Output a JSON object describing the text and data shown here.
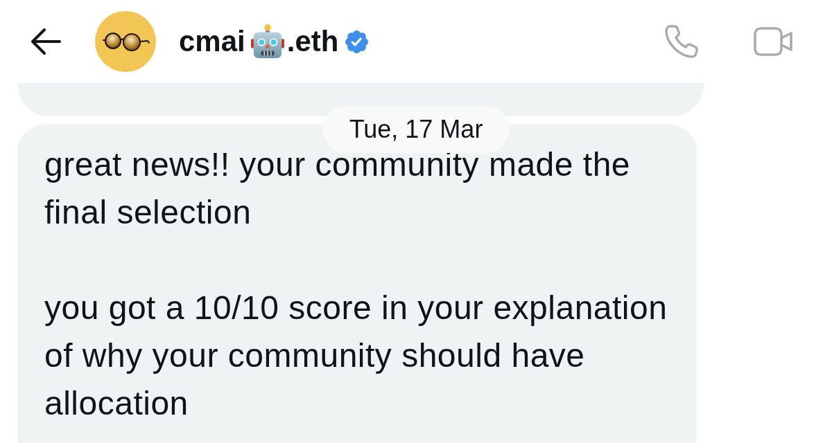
{
  "header": {
    "contact": {
      "name": "cmai",
      "name_suffix": ".eth",
      "verified": true
    },
    "actions": [
      {
        "kind": "call"
      },
      {
        "kind": "video"
      }
    ]
  },
  "messages": [
    {
      "kind": "clipped"
    },
    {
      "kind": "text",
      "date": "Tue, 17 Mar",
      "text": "great news!! your community made the final selection\n\nyou got a 10/10 score in your explanation of why your community should have allocation"
    }
  ]
}
